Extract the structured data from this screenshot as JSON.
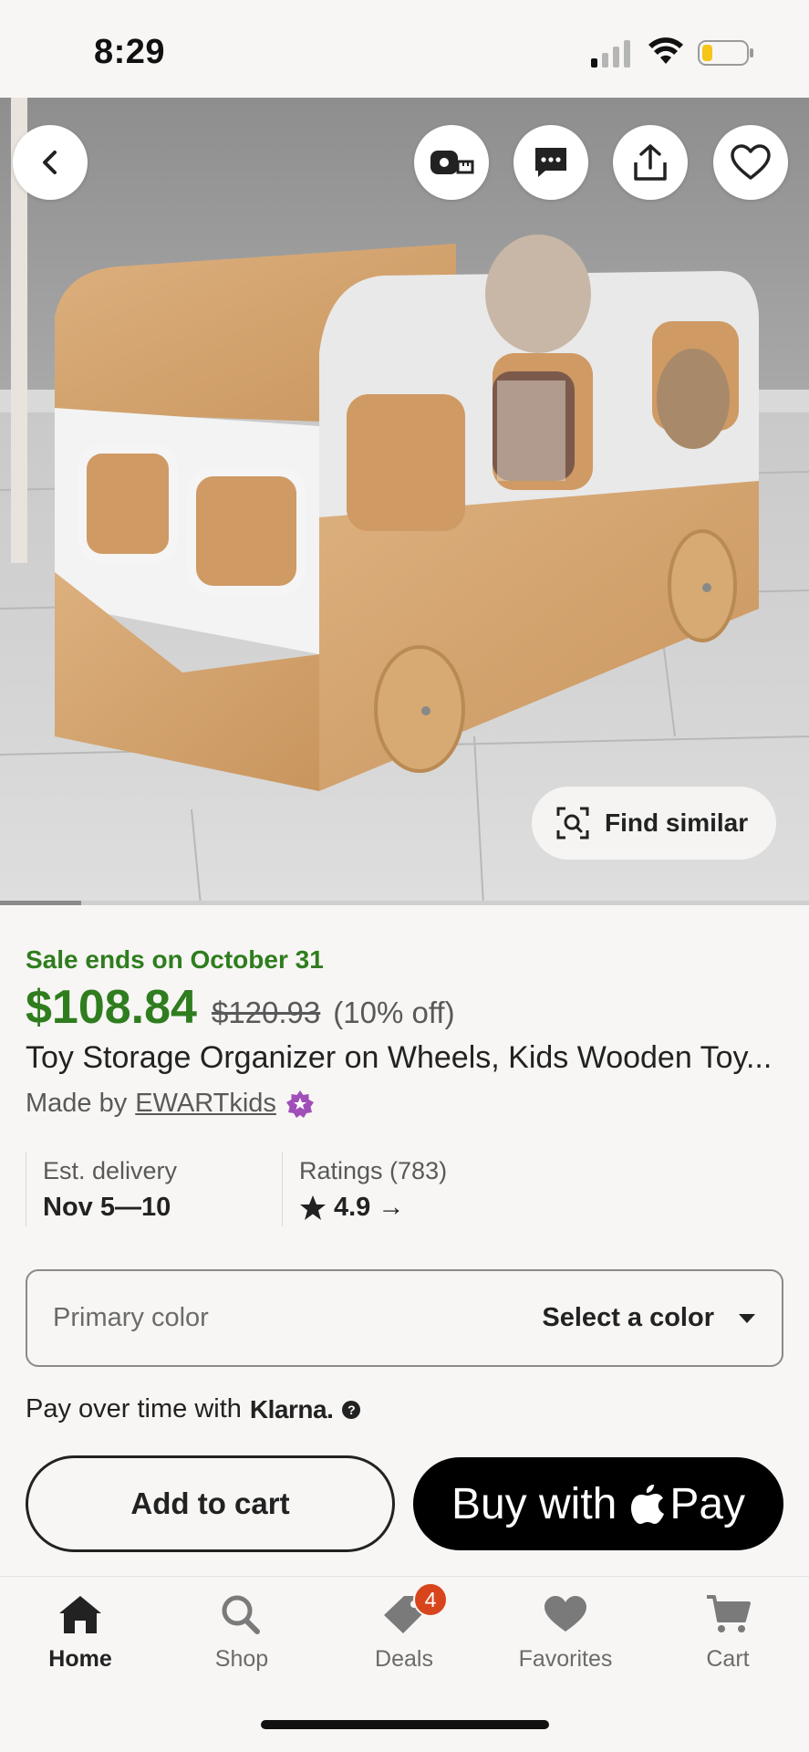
{
  "status_bar": {
    "time": "8:29",
    "icons": [
      "signal-icon",
      "wifi-icon",
      "battery-icon"
    ]
  },
  "hero": {
    "top_actions": [
      "back-icon",
      "measure-icon",
      "message-icon",
      "share-icon",
      "favorite-icon"
    ],
    "find_similar_label": "Find similar",
    "image_progress": 0.1
  },
  "product": {
    "sale_text": "Sale ends on October 31",
    "price": "$108.84",
    "original_price": "$120.93",
    "discount": "(10% off)",
    "title": "Toy Storage Organizer on Wheels, Kids Wooden Toy...",
    "made_by_prefix": "Made by",
    "shop_name": "EWARTkids",
    "delivery_label": "Est. delivery",
    "delivery_value": "Nov 5—10",
    "ratings_label": "Ratings (783)",
    "rating_value": "4.9",
    "rating_arrow": "→"
  },
  "color_select": {
    "label": "Primary color",
    "value": "Select a color"
  },
  "klarna": {
    "prefix": "Pay over time with",
    "brand": "Klarna.",
    "help": "?"
  },
  "actions": {
    "add_to_cart": "Add to cart",
    "buy_with": "Buy with",
    "pay": "Pay"
  },
  "nav": {
    "items": [
      {
        "label": "Home",
        "icon": "home-icon",
        "active": true
      },
      {
        "label": "Shop",
        "icon": "search-icon"
      },
      {
        "label": "Deals",
        "icon": "tag-icon",
        "badge": "4"
      },
      {
        "label": "Favorites",
        "icon": "heart-icon"
      },
      {
        "label": "Cart",
        "icon": "cart-icon"
      }
    ]
  },
  "colors": {
    "sale_green": "#2f7d1e",
    "badge_orange": "#d8451d",
    "star_purple": "#a04fb8"
  }
}
